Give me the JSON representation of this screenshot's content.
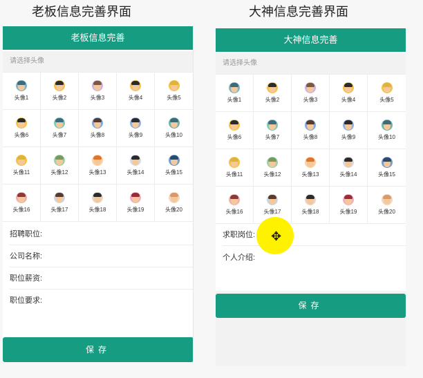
{
  "captions": {
    "left": "老板信息完善界面",
    "right": "大神信息完善界面"
  },
  "boss": {
    "header": "老板信息完善",
    "avatar_prompt": "请选择头像",
    "avatars": [
      "头像1",
      "头像2",
      "头像3",
      "头像4",
      "头像5",
      "头像6",
      "头像7",
      "头像8",
      "头像9",
      "头像10",
      "头像11",
      "头像12",
      "头像13",
      "头像14",
      "头像15",
      "头像16",
      "头像17",
      "头像18",
      "头像19",
      "头像20"
    ],
    "fields": [
      "招聘职位:",
      "公司名称:",
      "职位薪资:",
      "职位要求:"
    ],
    "save_label": "保存"
  },
  "god": {
    "header": "大神信息完善",
    "avatar_prompt": "请选择头像",
    "avatars": [
      "头像1",
      "头像2",
      "头像3",
      "头像4",
      "头像5",
      "头像6",
      "头像7",
      "头像8",
      "头像9",
      "头像10",
      "头像11",
      "头像12",
      "头像13",
      "头像14",
      "头像15",
      "头像16",
      "头像17",
      "头像18",
      "头像19",
      "头像20"
    ],
    "fields": [
      "求职岗位:",
      "个人介绍:"
    ],
    "save_label": "保存"
  },
  "avatar_colors": {
    "hair": [
      "#3d6b7c",
      "#2b2b2b",
      "#7d5a3c",
      "#2b2b2b",
      "#e0b33a",
      "#2b2b2b",
      "#3d6b7c",
      "#5a3b2b",
      "#2b2b2b",
      "#3d6b7c",
      "#e0b33a",
      "#7a9a5c",
      "#e0742a",
      "#2b2b2b",
      "#2b4b6b",
      "#8b3a3a",
      "#5a3b2b",
      "#2b2b2b",
      "#9b2b3b",
      "#d89a6a"
    ],
    "bg": [
      "#7fb5c9",
      "#f5c24a",
      "#c9b3e8",
      "#f5c24a",
      "#f5c24a",
      "#f5c24a",
      "#7fc9b5",
      "#7fa9e8",
      "#8fb0e0",
      "#6fb5a9",
      "#f5c24a",
      "#9fd0a9",
      "#ffd0a0",
      "#d6dbe6",
      "#6f9fd0",
      "#f0b0b0",
      "#c9d6e6",
      "#e6d6c9",
      "#f0b0c0",
      "#f5d6c0"
    ]
  }
}
